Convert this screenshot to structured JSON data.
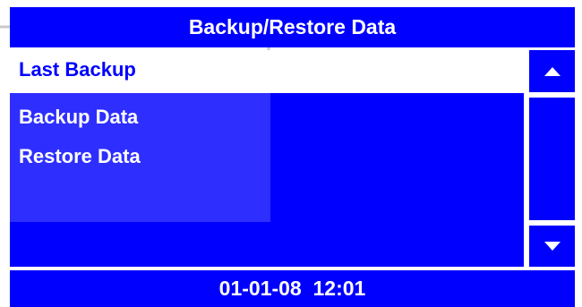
{
  "header": {
    "title": "Backup/Restore Data"
  },
  "menu": {
    "items": [
      {
        "label": "Last Backup",
        "selected": true
      },
      {
        "label": "Backup Data",
        "selected": false
      },
      {
        "label": "Restore Data",
        "selected": false
      }
    ]
  },
  "scrollbar": {
    "up_icon": "triangle-up-icon",
    "down_icon": "triangle-down-icon"
  },
  "footer": {
    "datetime": "01-01-08  12:01"
  },
  "colors": {
    "panel": "#0000ff",
    "text": "#ffffff",
    "selected_background": "#ffffff",
    "selected_text": "#0000ff"
  }
}
